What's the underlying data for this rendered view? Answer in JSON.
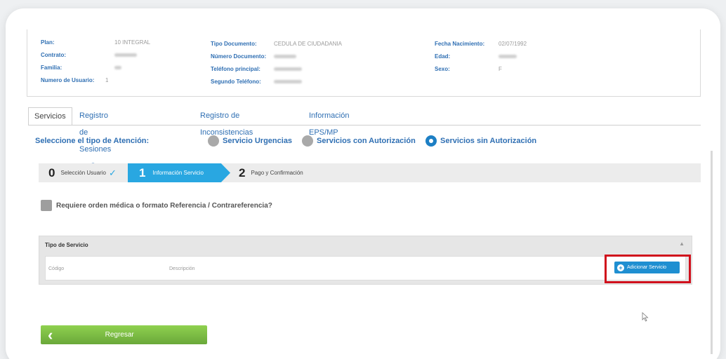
{
  "patient": {
    "col1": [
      {
        "label": "Plan:",
        "value": "10 INTEGRAL"
      },
      {
        "label": "Contrato:",
        "value": ""
      },
      {
        "label": "Familia:",
        "value": ""
      },
      {
        "label": "Numero de Usuario:",
        "value": "1"
      }
    ],
    "col2": [
      {
        "label": "Tipo Documento:",
        "value": "CEDULA DE CIUDADANIA"
      },
      {
        "label": "Número Documento:",
        "value": ""
      },
      {
        "label": "Teléfono principal:",
        "value": ""
      },
      {
        "label": "Segundo Teléfono:",
        "value": ""
      }
    ],
    "col3": [
      {
        "label": "Fecha Nacimiento:",
        "value": "02/07/1992"
      },
      {
        "label": "Edad:",
        "value": ""
      },
      {
        "label": "Sexo:",
        "value": "F"
      }
    ]
  },
  "tabs": [
    "Servicios",
    "Registro de Sesiones en Curso",
    "Registro de Inconsistencias",
    "Información EPS/MP"
  ],
  "attention": {
    "title": "Seleccione el tipo de Atención:",
    "options": [
      "Servicio Urgencias",
      "Servicios con Autorización",
      "Servicios sin Autorización"
    ],
    "selected": "Servicios sin Autorización"
  },
  "steps": [
    {
      "num": "0",
      "label": "Selección Usuario"
    },
    {
      "num": "1",
      "label": "Información Servicio"
    },
    {
      "num": "2",
      "label": "Pago y Confirmación"
    }
  ],
  "requirement_label": "Requiere orden médica o formato Referencia / Contrareferencia?",
  "service_panel": {
    "title": "Tipo de Servicio",
    "columns": [
      "Código",
      "Descripción"
    ],
    "add_button": "Adicionar Servicio"
  },
  "back_button": "Regresar",
  "colors": {
    "accent": "#29a7e1",
    "link": "#2f6fb3",
    "back": "#7dbf45",
    "highlight": "#d0101c"
  }
}
